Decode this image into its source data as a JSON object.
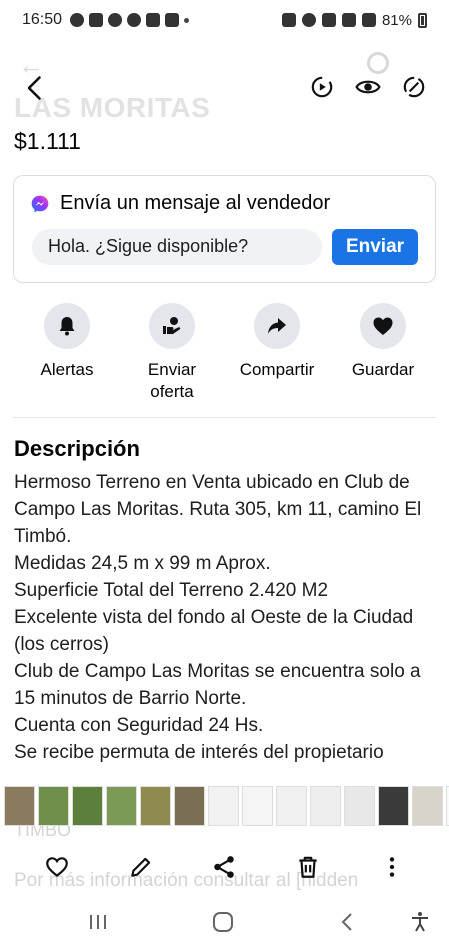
{
  "status_bar": {
    "time": "16:50",
    "battery": "81%"
  },
  "ghost": {
    "title": "LAS MORITAS",
    "behind_text_1": "TIMBÓ",
    "behind_text_2": "Por más información consultar al [hidden"
  },
  "listing": {
    "price": "$1.111"
  },
  "message": {
    "title": "Envía un mensaje al vendedor",
    "input_value": "Hola. ¿Sigue disponible?",
    "send_label": "Enviar"
  },
  "actions": [
    {
      "label": "Alertas",
      "icon": "bell-icon"
    },
    {
      "label": "Enviar oferta",
      "icon": "offer-hand-icon"
    },
    {
      "label": "Compartir",
      "icon": "share-arrow-icon"
    },
    {
      "label": "Guardar",
      "icon": "heart-icon"
    }
  ],
  "description": {
    "title": "Descripción",
    "lines": [
      "Hermoso Terreno en Venta ubicado en Club de Campo Las Moritas. Ruta 305, km 11, camino El Timbó.",
      "Medidas 24,5 m x 99 m Aprox.",
      "Superficie Total del Terreno 2.420 M2",
      "Excelente vista del fondo al Oeste de la Ciudad (los cerros)",
      "Club de Campo Las Moritas se encuentra solo a 15 minutos de Barrio Norte.",
      "Cuenta con Seguridad 24 Hs.",
      "Se recibe permuta de interés del propietario"
    ]
  },
  "thumbnails": [
    "#8a7a5e",
    "#6f8f4a",
    "#5d7f3c",
    "#7c9a55",
    "#8f8a50",
    "#7a6e55",
    "#f2f2f2",
    "#f5f5f5",
    "#f0f0f0",
    "#eeeeee",
    "#e8e8e8",
    "#3a3a3a",
    "#d9d4c9",
    "#fafafa"
  ],
  "colors": {
    "accent": "#1b74e4",
    "chip": "#e4e6eb",
    "input_bg": "#f0f2f5"
  }
}
